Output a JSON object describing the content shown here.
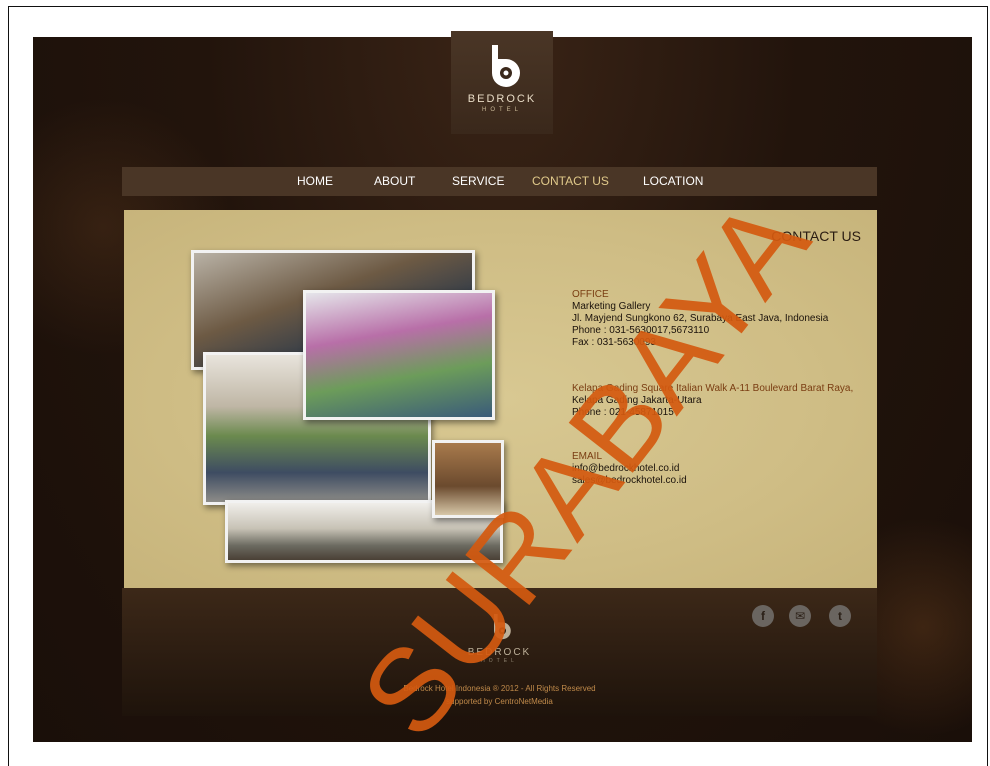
{
  "logo": {
    "name": "BEDROCK",
    "sub": "HOTEL"
  },
  "nav": [
    {
      "label": "HOME",
      "active": false
    },
    {
      "label": "ABOUT",
      "active": false
    },
    {
      "label": "SERVICE",
      "active": false
    },
    {
      "label": "CONTACT US",
      "active": true
    },
    {
      "label": "LOCATION",
      "active": false
    }
  ],
  "content": {
    "title": "CONTACT US",
    "office": {
      "heading": "OFFICE",
      "lines": [
        "Marketing Gallery",
        "Jl. Mayjend Sungkono 62, Surabaya East Java, Indonesia",
        "Phone : 031-5630017,5673110",
        "Fax : 031-5630093"
      ]
    },
    "branch": {
      "heading": "Kelapa Gading Square Italian Walk A-11 Boulevard Barat Raya,",
      "lines": [
        "Kelapa Gading Jakarta-Utara",
        "Phone : 021-45871015"
      ]
    },
    "email": {
      "heading": "EMAIL",
      "lines": [
        "info@bedrockhotel.co.id",
        "sales@bedrockhotel.co.id"
      ]
    }
  },
  "footer": {
    "logo_name": "BEDROCK",
    "logo_sub": "HOTEL",
    "copyright": "Bedrock Hotel Indonesia ® 2012 - All Rights Reserved",
    "supported": "supported by CentroNetMedia",
    "social": [
      "facebook-icon",
      "mail-icon",
      "twitter-icon"
    ]
  },
  "watermark": "SURABAYA",
  "colors": {
    "accent": "#e0c98a",
    "brown": "#4a3626",
    "heading": "#7a3d12",
    "watermark": "#d45a10"
  }
}
